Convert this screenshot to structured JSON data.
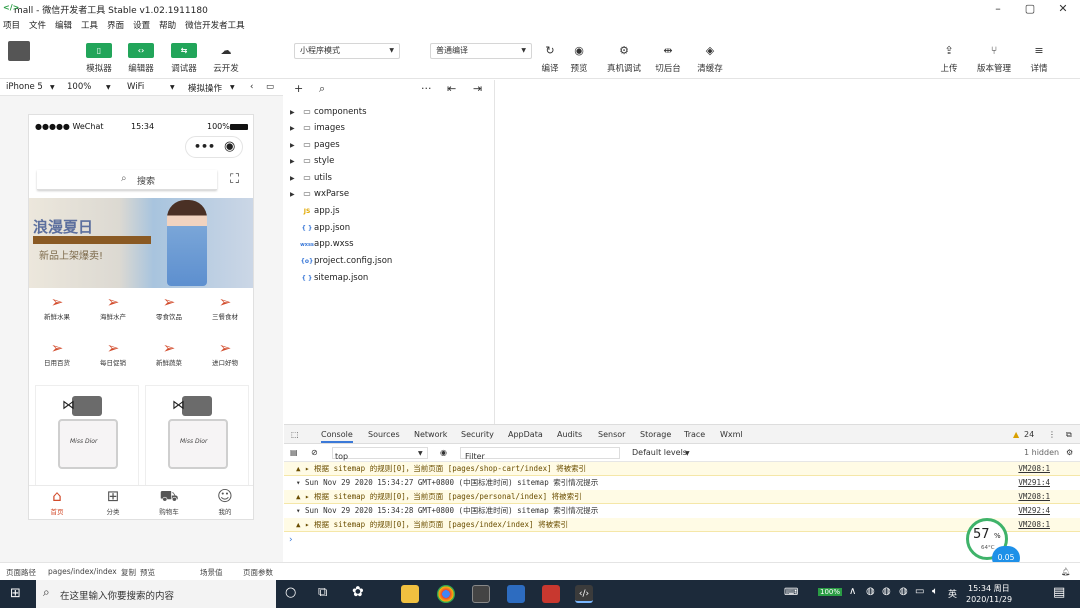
{
  "window": {
    "title": "mall - 微信开发者工具 Stable v1.02.1911180"
  },
  "menu": [
    "项目",
    "文件",
    "编辑",
    "工具",
    "界面",
    "设置",
    "帮助",
    "微信开发者工具"
  ],
  "toolbar": {
    "simulator": "模拟器",
    "editor": "编辑器",
    "debugger": "调试器",
    "cloud": "云开发",
    "mode_select": "小程序模式",
    "compile_select": "普通编译",
    "compile": "编译",
    "preview": "预览",
    "remote_debug": "真机调试",
    "background": "切后台",
    "clear_cache": "清缓存",
    "upload": "上传",
    "version": "版本管理",
    "details": "详情"
  },
  "simbar": {
    "device": "iPhone 5",
    "zoom": "100%",
    "network": "WiFi",
    "sim_op": "模拟操作"
  },
  "phone": {
    "carrier": "●●●●● WeChat",
    "time": "15:34",
    "battery": "100%",
    "search_placeholder": "搜索",
    "banner_title": "浪漫夏日",
    "banner_sub": "新品上架爆卖!",
    "categories": [
      "新鲜水果",
      "海鲜水产",
      "零食饮品",
      "三餐食材",
      "日用百货",
      "每日促销",
      "新鲜蔬菜",
      "进口好物"
    ],
    "product_brand": "Miss Dior",
    "tabs": [
      "首页",
      "分类",
      "购物车",
      "我的"
    ]
  },
  "explorer": {
    "folders": [
      "components",
      "images",
      "pages",
      "style",
      "utils",
      "wxParse"
    ],
    "files": [
      {
        "name": "app.js",
        "icon": "JS",
        "color": "#e0a800"
      },
      {
        "name": "app.json",
        "icon": "{ }",
        "color": "#3b79d8"
      },
      {
        "name": "app.wxss",
        "icon": "wxss",
        "color": "#3b79d8"
      },
      {
        "name": "project.config.json",
        "icon": "{o}",
        "color": "#3b79d8"
      },
      {
        "name": "sitemap.json",
        "icon": "{ }",
        "color": "#3b79d8"
      }
    ]
  },
  "devtools": {
    "tabs": [
      "Console",
      "Sources",
      "Network",
      "Security",
      "AppData",
      "Audits",
      "Sensor",
      "Storage",
      "Trace",
      "Wxml"
    ],
    "warning_count": "24",
    "context": "top",
    "filter_placeholder": "Filter",
    "levels": "Default levels",
    "hidden": "1 hidden"
  },
  "console_logs": [
    {
      "type": "warn",
      "text": "▲ ▸ 根据 sitemap 的规则[0]，当前页面 [pages/shop-cart/index] 将被索引",
      "src": "VM208:1"
    },
    {
      "type": "info",
      "text": "▾ Sun Nov 29 2020 15:34:27 GMT+0800 (中国标准时间) sitemap 索引情况提示",
      "src": "VM291:4"
    },
    {
      "type": "warn",
      "text": "▲ ▸ 根据 sitemap 的规则[0]，当前页面 [pages/personal/index] 将被索引",
      "src": "VM208:1"
    },
    {
      "type": "info",
      "text": "▾ Sun Nov 29 2020 15:34:28 GMT+0800 (中国标准时间) sitemap 索引情况提示",
      "src": "VM292:4"
    },
    {
      "type": "warn",
      "text": "▲ ▸ 根据 sitemap 的规则[0]，当前页面 [pages/index/index] 将被索引",
      "src": "VM208:1"
    }
  ],
  "statusbar": {
    "page_path_label": "页面路径",
    "page_path": "pages/index/index",
    "copy": "复制",
    "preview": "预览",
    "scene": "场景值",
    "params": "页面参数"
  },
  "gauge": {
    "percent": "57",
    "unit": "%",
    "temp": "64°C",
    "speed": "0.05"
  },
  "taskbar": {
    "search_placeholder": "在这里输入你要搜索的内容",
    "battery": "100%",
    "time": "15:34 周日",
    "date": "2020/11/29",
    "ime": "英"
  }
}
